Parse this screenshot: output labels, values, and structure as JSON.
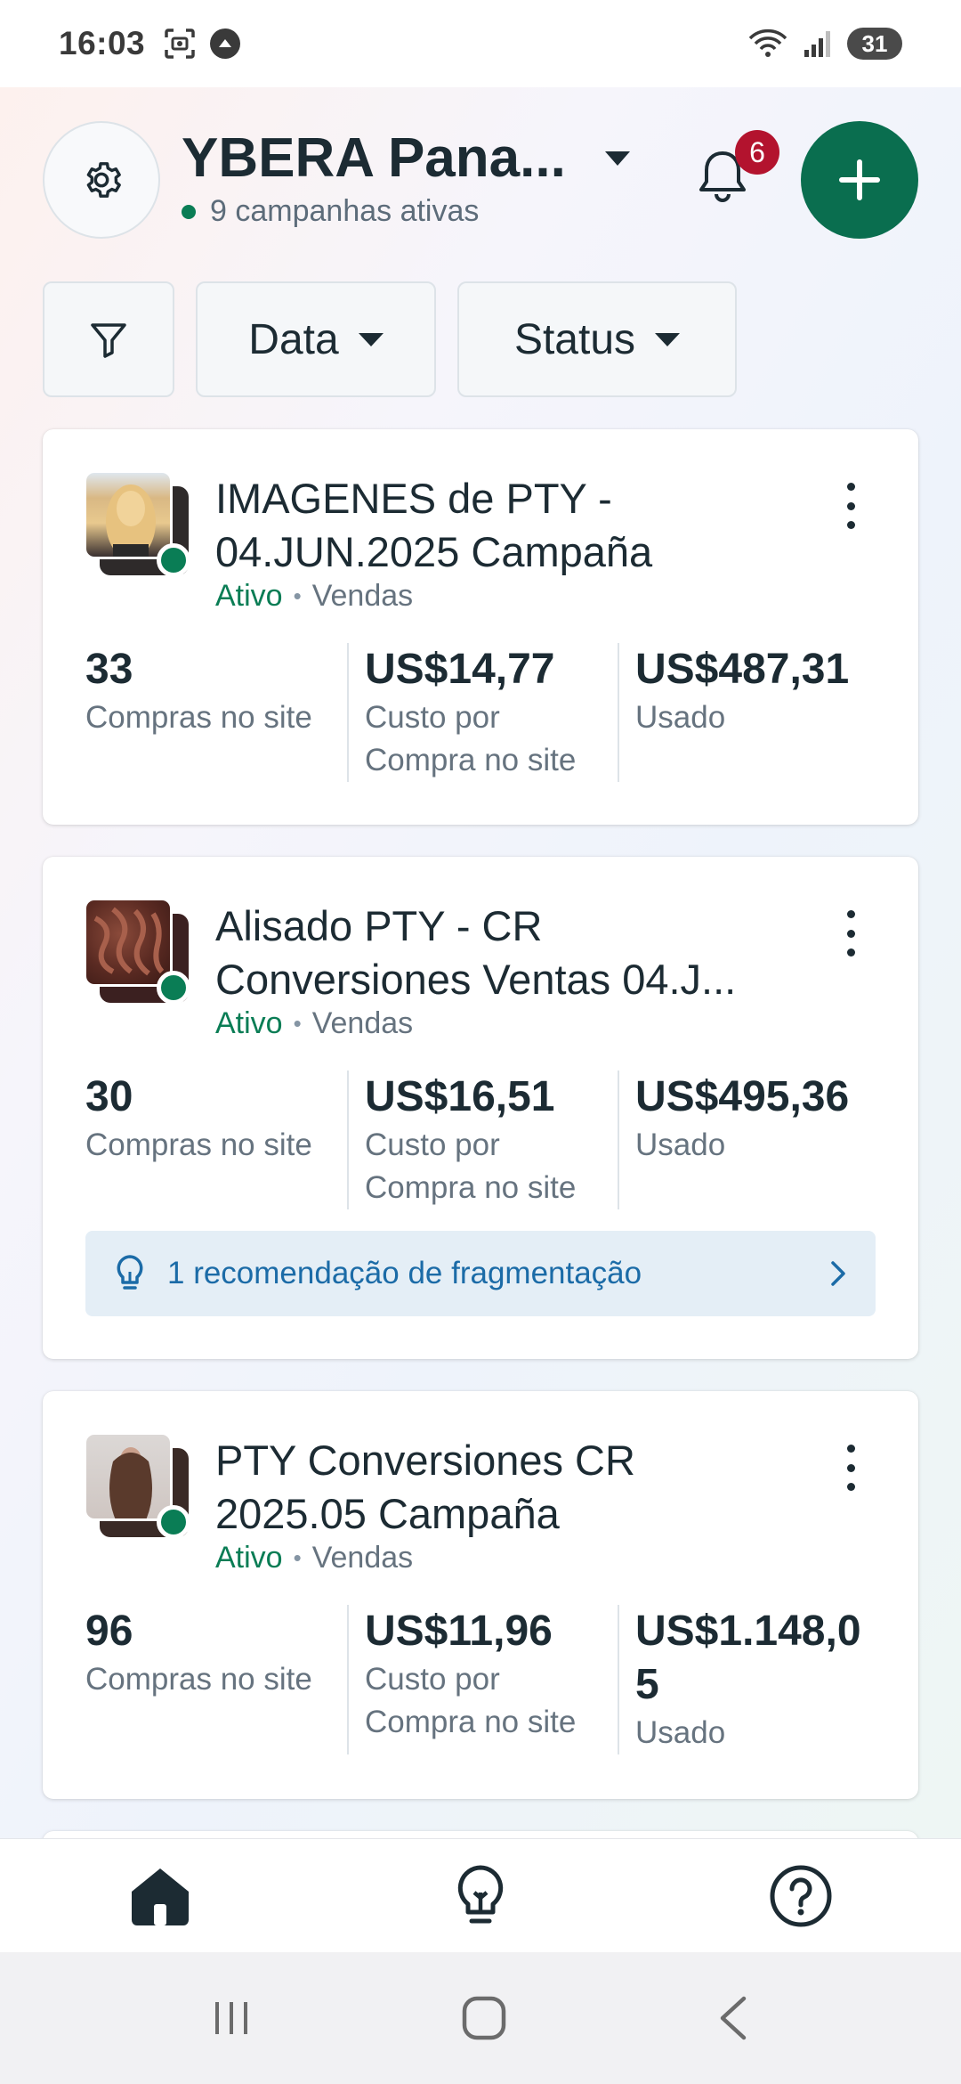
{
  "status_bar": {
    "time": "16:03",
    "battery": "31"
  },
  "header": {
    "account_name": "YBERA Pana...",
    "active_campaigns": "9 campanhas ativas",
    "notifications_count": "6"
  },
  "filters": {
    "date_label": "Data",
    "status_label": "Status"
  },
  "campaigns": [
    {
      "title_line1": "IMAGENES de PTY -",
      "title_line2": "04.JUN.2025 Campaña",
      "status": "Ativo",
      "separator": "•",
      "objective": "Vendas",
      "metrics": [
        {
          "value": "33",
          "label": "Compras no site"
        },
        {
          "value": "US$14,77",
          "label": "Custo por Compra no site"
        },
        {
          "value": "US$487,31",
          "label": "Usado"
        }
      ]
    },
    {
      "title_line1": "Alisado PTY - CR",
      "title_line2": "Conversiones Ventas 04.J...",
      "status": "Ativo",
      "separator": "•",
      "objective": "Vendas",
      "metrics": [
        {
          "value": "30",
          "label": "Compras no site"
        },
        {
          "value": "US$16,51",
          "label": "Custo por Compra no site"
        },
        {
          "value": "US$495,36",
          "label": "Usado"
        }
      ],
      "recommendation": "1 recomendação de fragmentação"
    },
    {
      "title_line1": "PTY Conversiones CR",
      "title_line2": "2025.05 Campaña",
      "status": "Ativo",
      "separator": "•",
      "objective": "Vendas",
      "metrics": [
        {
          "value": "96",
          "label": "Compras no site"
        },
        {
          "value": "US$11,96",
          "label": "Custo por Compra no site"
        },
        {
          "value": "US$1.148,05",
          "label": "Usado"
        }
      ]
    }
  ],
  "bottom_nav": {
    "items": [
      "home-icon",
      "lightbulb-icon",
      "help-icon"
    ]
  },
  "colors": {
    "brand_green": "#0a6e4f",
    "active_green": "#0a7d55",
    "badge_red": "#b3132e",
    "link_blue": "#1b6ba7"
  }
}
